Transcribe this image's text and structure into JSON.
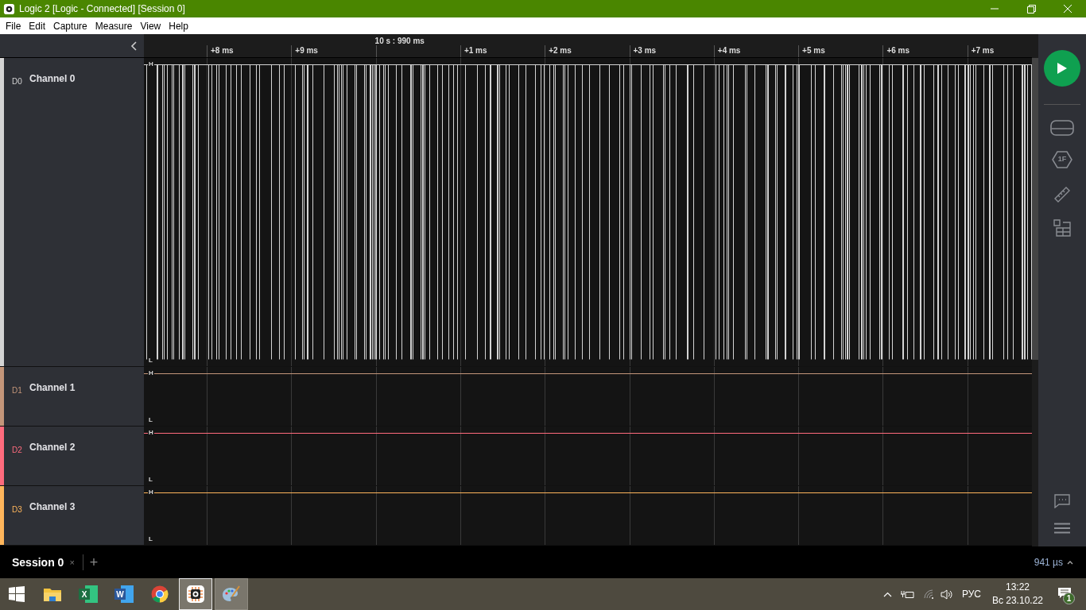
{
  "window": {
    "title": "Logic 2 [Logic - Connected] [Session 0]"
  },
  "menu": [
    "File",
    "Edit",
    "Capture",
    "Measure",
    "View",
    "Help"
  ],
  "ruler": {
    "ticks_before": [
      "+8 ms",
      "+9 ms"
    ],
    "anchor": "10 s : 990 ms",
    "ticks_after": [
      "+1 ms",
      "+2 ms",
      "+3 ms",
      "+4 ms",
      "+5 ms",
      "+6 ms",
      "+7 ms"
    ]
  },
  "channels": [
    {
      "label": "D0",
      "name": "Channel 0",
      "color": "#d4d4d4",
      "kind": "toggling",
      "high": "H",
      "low": "L"
    },
    {
      "label": "D1",
      "name": "Channel 1",
      "color": "#c4967a",
      "kind": "flat",
      "high": "H",
      "low": "L"
    },
    {
      "label": "D2",
      "name": "Channel 2",
      "color": "#ff6b7d",
      "kind": "flat",
      "high": "H",
      "low": "L"
    },
    {
      "label": "D3",
      "name": "Channel 3",
      "color": "#ffb65c",
      "kind": "flat",
      "high": "H",
      "low": "L"
    }
  ],
  "sidebar": {
    "analyzer_badge": "1F"
  },
  "sessions": [
    {
      "label": "Session 0",
      "close": "×",
      "selected": true
    }
  ],
  "new_session": "+",
  "zoom_readout": "941 µs",
  "taskbar": {
    "apps": [
      {
        "kind": "start",
        "open": false,
        "selected": false
      },
      {
        "kind": "explorer",
        "open": false,
        "selected": false
      },
      {
        "kind": "excel",
        "letter": "X",
        "open": false,
        "selected": false
      },
      {
        "kind": "word",
        "letter": "W",
        "open": false,
        "selected": false
      },
      {
        "kind": "chrome",
        "open": false,
        "selected": false
      },
      {
        "kind": "logic",
        "open": true,
        "selected": true
      },
      {
        "kind": "paint",
        "open": true,
        "selected": false
      }
    ],
    "language": "РУС",
    "time": "13:22",
    "date": "Вс 23.10.22",
    "notifications": "1"
  }
}
